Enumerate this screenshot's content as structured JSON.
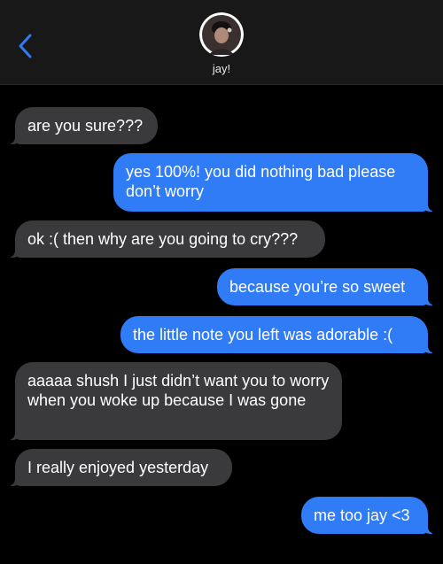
{
  "header": {
    "contact_name": "jay!",
    "back_icon": "chevron-left-icon",
    "accent_color": "#2f7cf6"
  },
  "messages": [
    {
      "from": "them",
      "text": "are you sure???"
    },
    {
      "from": "me",
      "text": "yes 100%! you did nothing bad please don’t worry"
    },
    {
      "from": "them",
      "text": "ok :( then why are you going to cry???"
    },
    {
      "from": "me",
      "text": "because you’re so sweet"
    },
    {
      "from": "me",
      "text": "the little note you left was adorable :("
    },
    {
      "from": "them",
      "text": "aaaaa shush I just didn’t want you to worry when you woke up because I was gone"
    },
    {
      "from": "them",
      "text": "I really enjoyed yesterday"
    },
    {
      "from": "me",
      "text": "me too jay <3"
    }
  ]
}
